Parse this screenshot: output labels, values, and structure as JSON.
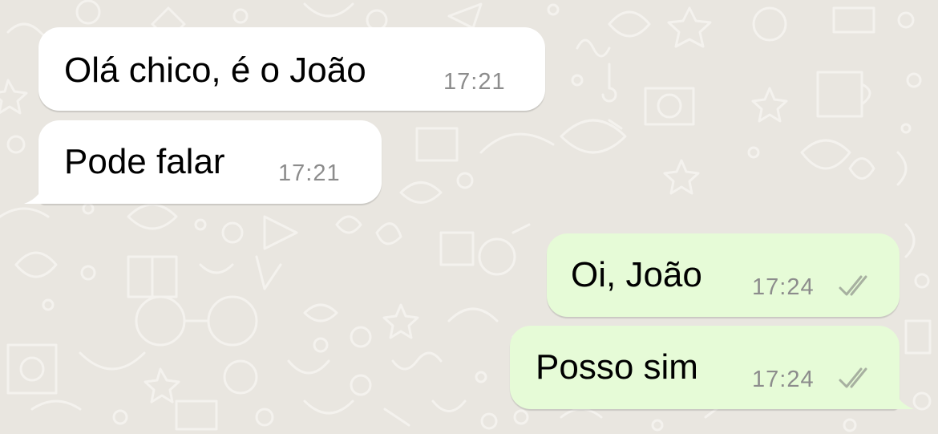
{
  "colors": {
    "chat_background": "#e9e6e0",
    "incoming_bubble": "#ffffff",
    "outgoing_bubble": "#e6fbd7",
    "timestamp": "#8c8c8c",
    "read_ticks": "#a7b0a0"
  },
  "messages": [
    {
      "direction": "incoming",
      "text": "Olá chico, é o João",
      "time": "17:21"
    },
    {
      "direction": "incoming",
      "text": "Pode falar",
      "time": "17:21"
    },
    {
      "direction": "outgoing",
      "text": "Oi, João",
      "time": "17:24",
      "status_icon": "double-check-icon"
    },
    {
      "direction": "outgoing",
      "text": "Posso sim",
      "time": "17:24",
      "status_icon": "double-check-icon"
    }
  ]
}
